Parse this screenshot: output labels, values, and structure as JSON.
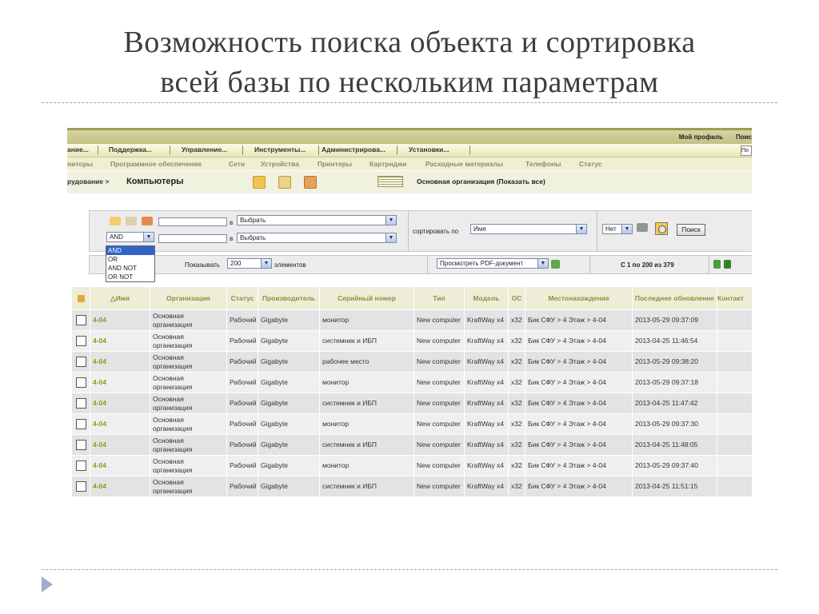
{
  "slide": {
    "title_lines": [
      "Возможность поиска объекта и сортировка",
      "всей базы по нескольким параметрам"
    ]
  },
  "app": {
    "top": {
      "profile": "Мой профиль",
      "search_cut": "Поис"
    },
    "menu": [
      "ание...",
      "Поддержка...",
      "Управление...",
      "Инструменты...",
      "Администрирова...",
      "Установки..."
    ],
    "menu_input": "По",
    "subnav": [
      "ниторы",
      "Программное обеспечение",
      "Сети",
      "Устройства",
      "Принтеры",
      "Картриджи",
      "Расходные материалы",
      "Телефоны",
      "Статус"
    ],
    "breadcrumb": {
      "prefix": "рудование >",
      "title": "Компьютеры"
    },
    "org_link": "Основная организация (Показать все)",
    "filter": {
      "in_label": "в",
      "select_placeholder": "Выбрать",
      "logic_value": "AND",
      "logic_options": [
        "AND",
        "OR",
        "AND NOT",
        "OR NOT"
      ],
      "sort_label": "сортировать по",
      "sort_value": "Имя",
      "order_value": "Нет",
      "search_button": "Поиск"
    },
    "pager": {
      "show_label": "Показывать",
      "page_size": "200",
      "elements_label": "элементов",
      "pdf_option": "Просмотреть PDF-документ",
      "range": "С 1 по 200 из 379"
    },
    "columns": [
      "Имя",
      "Организация",
      "Статус",
      "Производитель",
      "Серийный номер",
      "Тип",
      "Модель",
      "ОС",
      "Местонахождение",
      "Последнее обновление",
      "Контакт"
    ],
    "rows": [
      {
        "name": "4-04",
        "org": "Основная организация",
        "status": "Рабочий",
        "maker": "Gigabyte",
        "serial": "монитор",
        "type": "New computer",
        "model": "KraftWay x4",
        "os": "x32",
        "location": "Бик СФУ > 4 Этаж > 4-04",
        "updated": "2013-05-29 09:37:09"
      },
      {
        "name": "4-04",
        "org": "Основная организация",
        "status": "Рабочий",
        "maker": "Gigabyte",
        "serial": "системник и ИБП",
        "type": "New computer",
        "model": "KraftWay x4",
        "os": "x32",
        "location": "Бик СФУ > 4 Этаж > 4-04",
        "updated": "2013-04-25 11:46:54"
      },
      {
        "name": "4-04",
        "org": "Основная организация",
        "status": "Рабочий",
        "maker": "Gigabyte",
        "serial": "рабочее место",
        "type": "New computer",
        "model": "KraftWay x4",
        "os": "x32",
        "location": "Бик СФУ > 4 Этаж > 4-04",
        "updated": "2013-05-29 09:38:20"
      },
      {
        "name": "4-04",
        "org": "Основная организация",
        "status": "Рабочий",
        "maker": "Gigabyte",
        "serial": "монитор",
        "type": "New computer",
        "model": "KraftWay x4",
        "os": "x32",
        "location": "Бик СФУ > 4 Этаж > 4-04",
        "updated": "2013-05-29 09:37:18"
      },
      {
        "name": "4-04",
        "org": "Основная организация",
        "status": "Рабочий",
        "maker": "Gigabyte",
        "serial": "системник и ИБП",
        "type": "New computer",
        "model": "KraftWay x4",
        "os": "x32",
        "location": "Бик СФУ > 4 Этаж > 4-04",
        "updated": "2013-04-25 11:47:42"
      },
      {
        "name": "4-04",
        "org": "Основная организация",
        "status": "Рабочий",
        "maker": "Gigabyte",
        "serial": "монитор",
        "type": "New computer",
        "model": "KraftWay x4",
        "os": "x32",
        "location": "Бик СФУ > 4 Этаж > 4-04",
        "updated": "2013-05-29 09:37:30"
      },
      {
        "name": "4-04",
        "org": "Основная организация",
        "status": "Рабочий",
        "maker": "Gigabyte",
        "serial": "системник и ИБП",
        "type": "New computer",
        "model": "KraftWay x4",
        "os": "x32",
        "location": "Бик СФУ > 4 Этаж > 4-04",
        "updated": "2013-04-25 11:48:05"
      },
      {
        "name": "4-04",
        "org": "Основная организация",
        "status": "Рабочий",
        "maker": "Gigabyte",
        "serial": "монитор",
        "type": "New computer",
        "model": "KraftWay x4",
        "os": "x32",
        "location": "Бик СФУ > 4 Этаж > 4-04",
        "updated": "2013-05-29 09:37:40"
      },
      {
        "name": "4-04",
        "org": "Основная организация",
        "status": "Рабочий",
        "maker": "Gigabyte",
        "serial": "системник и ИБП",
        "type": "New computer",
        "model": "KraftWay x4",
        "os": "x32",
        "location": "Бик СФУ > 4 Этаж > 4-04",
        "updated": "2013-04-25 11:51:15"
      }
    ]
  },
  "colors": {
    "header_text": "#8d8e41",
    "name_link": "#8a9b1e",
    "topbar": "#c9c78f",
    "highlight": "#3163c5"
  }
}
